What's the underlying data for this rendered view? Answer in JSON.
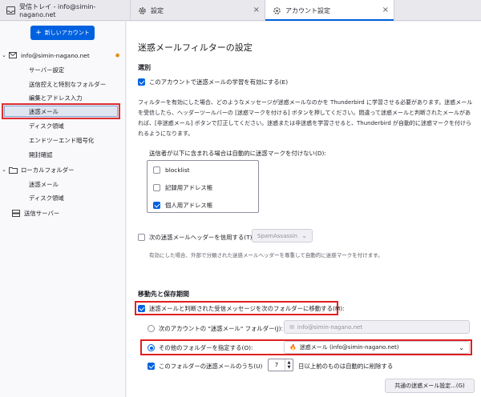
{
  "tabs": [
    {
      "label": "受信トレイ - info@simin-nagano.net",
      "icon": "inbox-icon"
    },
    {
      "label": "設定",
      "icon": "gear-icon"
    },
    {
      "label": "アカウント設定",
      "icon": "account-settings-icon"
    }
  ],
  "sidebar": {
    "new_account_label": "新しいアカウント",
    "account_label": "info@simin-nagano.net",
    "items": [
      "サーバー設定",
      "送信控えと特別なフォルダー",
      "編集とアドレス入力",
      "迷惑メール",
      "ディスク領域",
      "エンドツーエンド暗号化",
      "開封確認"
    ],
    "local_folders_label": "ローカルフォルダー",
    "local_items": [
      "迷惑メール",
      "ディスク領域"
    ],
    "outgoing_server_label": "送信サーバー"
  },
  "main": {
    "title": "迷惑メールフィルターの設定",
    "section_select": "選別",
    "enable_learning_label": "このアカウントで迷惑メールの学習を有効にする(E)",
    "description": "フィルターを有効にした場合、どのようなメッセージが迷惑メールなのかを Thunderbird に学習させる必要があります。迷惑メールを受信したら、ヘッダーツールバーの [迷惑マークを付ける] ボタンを押してください。間違って迷惑メールと判断されたメールがあれば、[非迷惑メール] ボタンで訂正してください。迷惑または非迷惑を学習させると、Thunderbird が自動的に迷惑マークを付けられるようになります。",
    "whitelist_label": "送信者が以下に含まれる場合は自動的に迷惑マークを付けない(D):",
    "address_books": [
      {
        "label": "blocklist",
        "checked": false
      },
      {
        "label": "記録用アドレス帳",
        "checked": false
      },
      {
        "label": "個人用アドレス帳",
        "checked": true
      }
    ],
    "trust_headers_label": "次の迷惑メールヘッダーを信用する(T):",
    "trust_headers_value": "SpamAssassin",
    "trust_headers_note": "有効にした場合、外部で分類された迷惑メールヘッダーを尊重して自動的に迷惑マークを付けます。",
    "section_move": "移動先と保存期間",
    "move_label": "迷惑メールと判断された受信メッセージを次のフォルダーに移動する(M):",
    "radio_account_label": "次のアカウントの \"迷惑メール\" フォルダー(J):",
    "radio_account_value": "info@simin-nagano.net",
    "radio_other_label": "その他のフォルダーを指定する(O):",
    "radio_other_value": "迷惑メール (info@simin-nagano.net)",
    "delete_label_prefix": "このフォルダーの迷惑メールのうち(U)",
    "delete_days": "7",
    "delete_label_suffix": "日以上前のものは自動的に削除する",
    "global_button_label": "共通の迷惑メール設定...(G)"
  },
  "colors": {
    "accent": "#0061e0",
    "highlight_border": "#e02020"
  }
}
